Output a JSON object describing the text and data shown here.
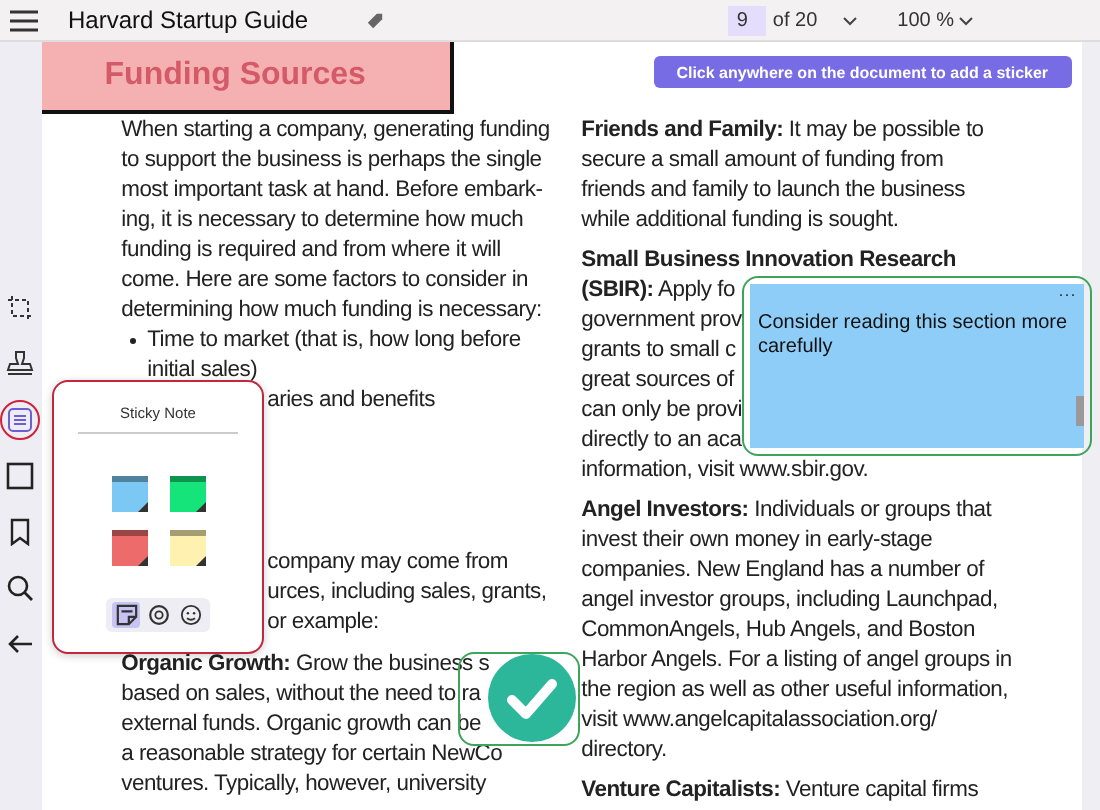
{
  "toolbar": {
    "title": "Harvard Startup Guide",
    "page_current": "9",
    "page_total": "of 20",
    "zoom": "100 %"
  },
  "sidebar": {
    "tools": [
      {
        "kind": "crop",
        "selected": false
      },
      {
        "kind": "stamp",
        "selected": false
      },
      {
        "kind": "note",
        "selected": true
      },
      {
        "kind": "shape",
        "selected": false
      },
      {
        "kind": "bookmark",
        "selected": false
      },
      {
        "kind": "search",
        "selected": false
      },
      {
        "kind": "back",
        "selected": false
      }
    ]
  },
  "document": {
    "heading": "Funding Sources",
    "hint_button": "Click anywhere on the document to add a sticker",
    "left_column": [
      {
        "kind": "para",
        "lines": [
          "When starting a company, generating funding",
          "to support the business is perhaps the single",
          "most important task at hand. Before embark-",
          "ing, it is necessary to determine how much",
          "funding is required and from where it will",
          "come. Here are some factors to consider in",
          "determining how much funding is necessary:"
        ]
      },
      {
        "kind": "bullet",
        "lines": [
          "Time to market (that is, how long before",
          "initial sales)"
        ]
      },
      {
        "kind": "partial",
        "lines": [
          "aries and benefits"
        ]
      },
      {
        "kind": "partial",
        "lines": [
          "company may come from",
          "urces, including sales, grants,",
          "or example:"
        ]
      },
      {
        "kind": "para",
        "lines": [
          "**Organic Growth:** Grow the business s",
          "based on sales, without the need to ra",
          "external funds. Organic growth can be",
          "a reasonable strategy for certain NewCo",
          "ventures. Typically, however, university"
        ]
      }
    ],
    "right_column": [
      {
        "kind": "para",
        "lines": [
          "**Friends and Family:** It may be possible to",
          "secure a small amount of funding from",
          "friends and family to launch the business",
          "while additional funding is sought."
        ]
      },
      {
        "kind": "para",
        "lines": [
          "**Small Business Innovation Research**",
          "**(SBIR):** Apply fo",
          "government prov",
          "grants to small c",
          "great sources of",
          "can only be provi",
          "directly to an aca",
          "information, visit www.sbir.gov."
        ]
      },
      {
        "kind": "para",
        "lines": [
          "**Angel Investors:** Individuals or groups that",
          "invest their own money in early-stage",
          "companies. New England has a number of",
          "angel investor groups, including Launchpad,",
          "CommonAngels, Hub Angels, and Boston",
          "Harbor Angels. For a listing of angel groups in",
          "the region as well as other useful information,",
          "visit www.angelcapitalassociation.org/",
          "directory."
        ]
      },
      {
        "kind": "para",
        "lines": [
          "**Venture Capitalists:** Venture capital firms"
        ]
      }
    ],
    "sticky": {
      "text": "Consider reading this section more carefully",
      "menu": "···"
    }
  },
  "sticky_popup": {
    "title": "Sticky Note",
    "notes": [
      {
        "color": "#7cc8f5"
      },
      {
        "color": "#14e479"
      },
      {
        "color": "#ee6b6b"
      },
      {
        "color": "#fff1b0"
      }
    ],
    "tabs": [
      {
        "kind": "sticky",
        "selected": true
      },
      {
        "kind": "attach",
        "selected": false
      },
      {
        "kind": "emoji",
        "selected": false
      }
    ]
  }
}
